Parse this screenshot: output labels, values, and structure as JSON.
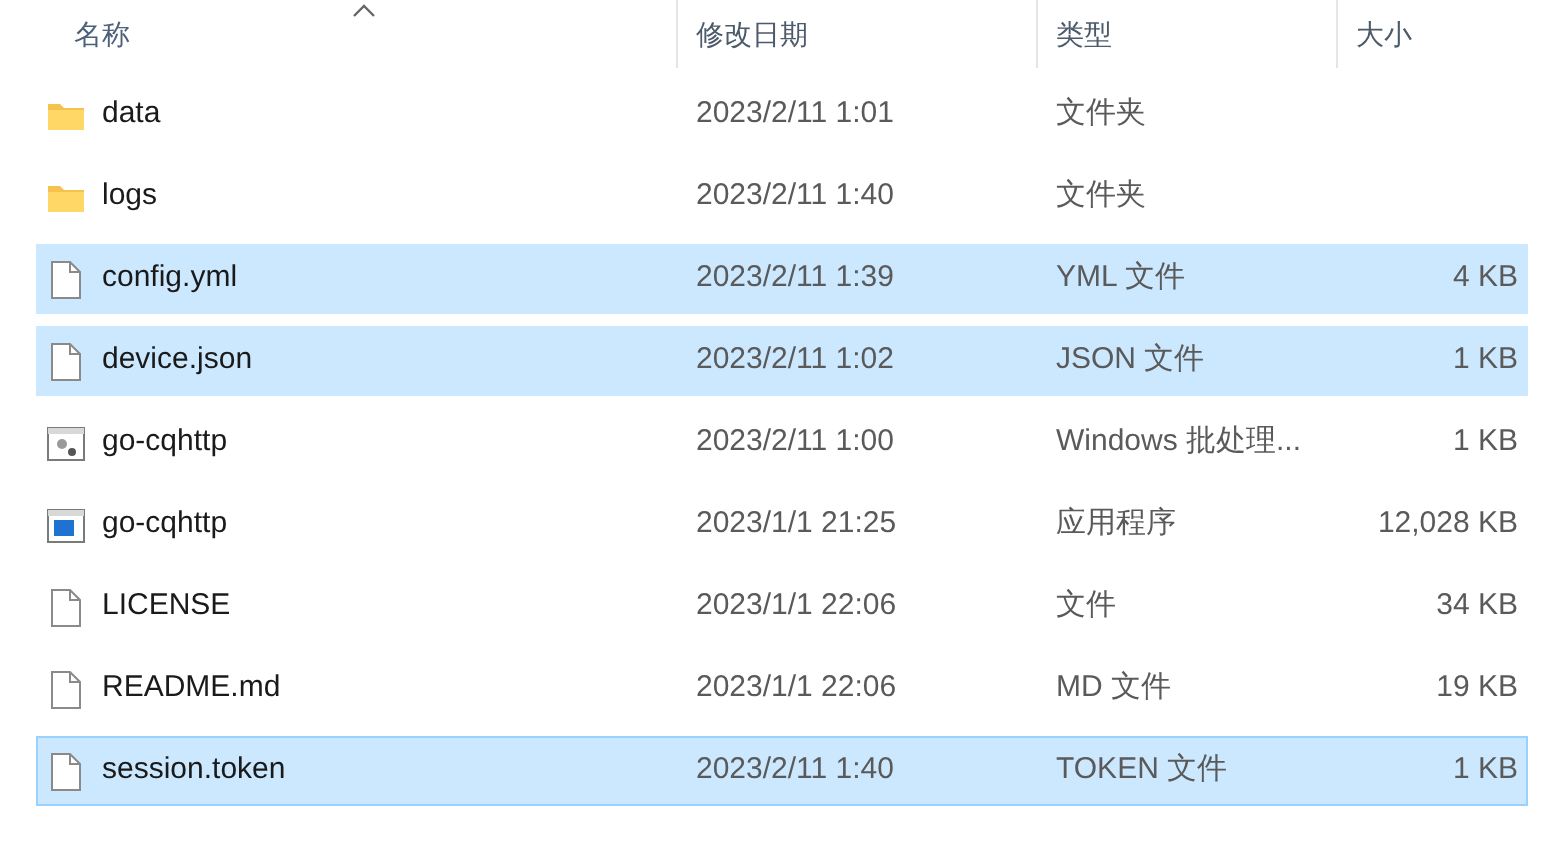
{
  "columns": [
    {
      "label": "名称",
      "sorted": true
    },
    {
      "label": "修改日期",
      "sorted": false
    },
    {
      "label": "类型",
      "sorted": false
    },
    {
      "label": "大小",
      "sorted": false
    }
  ],
  "rows": [
    {
      "kind": "folder",
      "name": "data",
      "modified": "2023/2/11 1:01",
      "type": "文件夹",
      "selected": false,
      "focused": false
    },
    {
      "kind": "folder",
      "name": "logs",
      "modified": "2023/2/11 1:40",
      "type": "文件夹",
      "selected": false,
      "focused": false
    },
    {
      "kind": "file",
      "name": "config.yml",
      "modified": "2023/2/11 1:39",
      "type": "YML 文件",
      "size": "4 KB",
      "selected": true,
      "focused": false
    },
    {
      "kind": "file",
      "name": "device.json",
      "modified": "2023/2/11 1:02",
      "type": "JSON 文件",
      "size": "1 KB",
      "selected": true,
      "focused": false
    },
    {
      "kind": "batch",
      "name": "go-cqhttp",
      "modified": "2023/2/11 1:00",
      "type": "Windows 批处理...",
      "size": "1 KB",
      "selected": false,
      "focused": false
    },
    {
      "kind": "app",
      "name": "go-cqhttp",
      "modified": "2023/1/1 21:25",
      "type": "应用程序",
      "size": "12,028 KB",
      "selected": false,
      "focused": false
    },
    {
      "kind": "file",
      "name": "LICENSE",
      "modified": "2023/1/1 22:06",
      "type": "文件",
      "size": "34 KB",
      "selected": false,
      "focused": false
    },
    {
      "kind": "file",
      "name": "README.md",
      "modified": "2023/1/1 22:06",
      "type": "MD 文件",
      "size": "19 KB",
      "selected": false,
      "focused": false
    },
    {
      "kind": "file",
      "name": "session.token",
      "modified": "2023/2/11 1:40",
      "type": "TOKEN 文件",
      "size": "1 KB",
      "selected": true,
      "focused": true
    }
  ]
}
